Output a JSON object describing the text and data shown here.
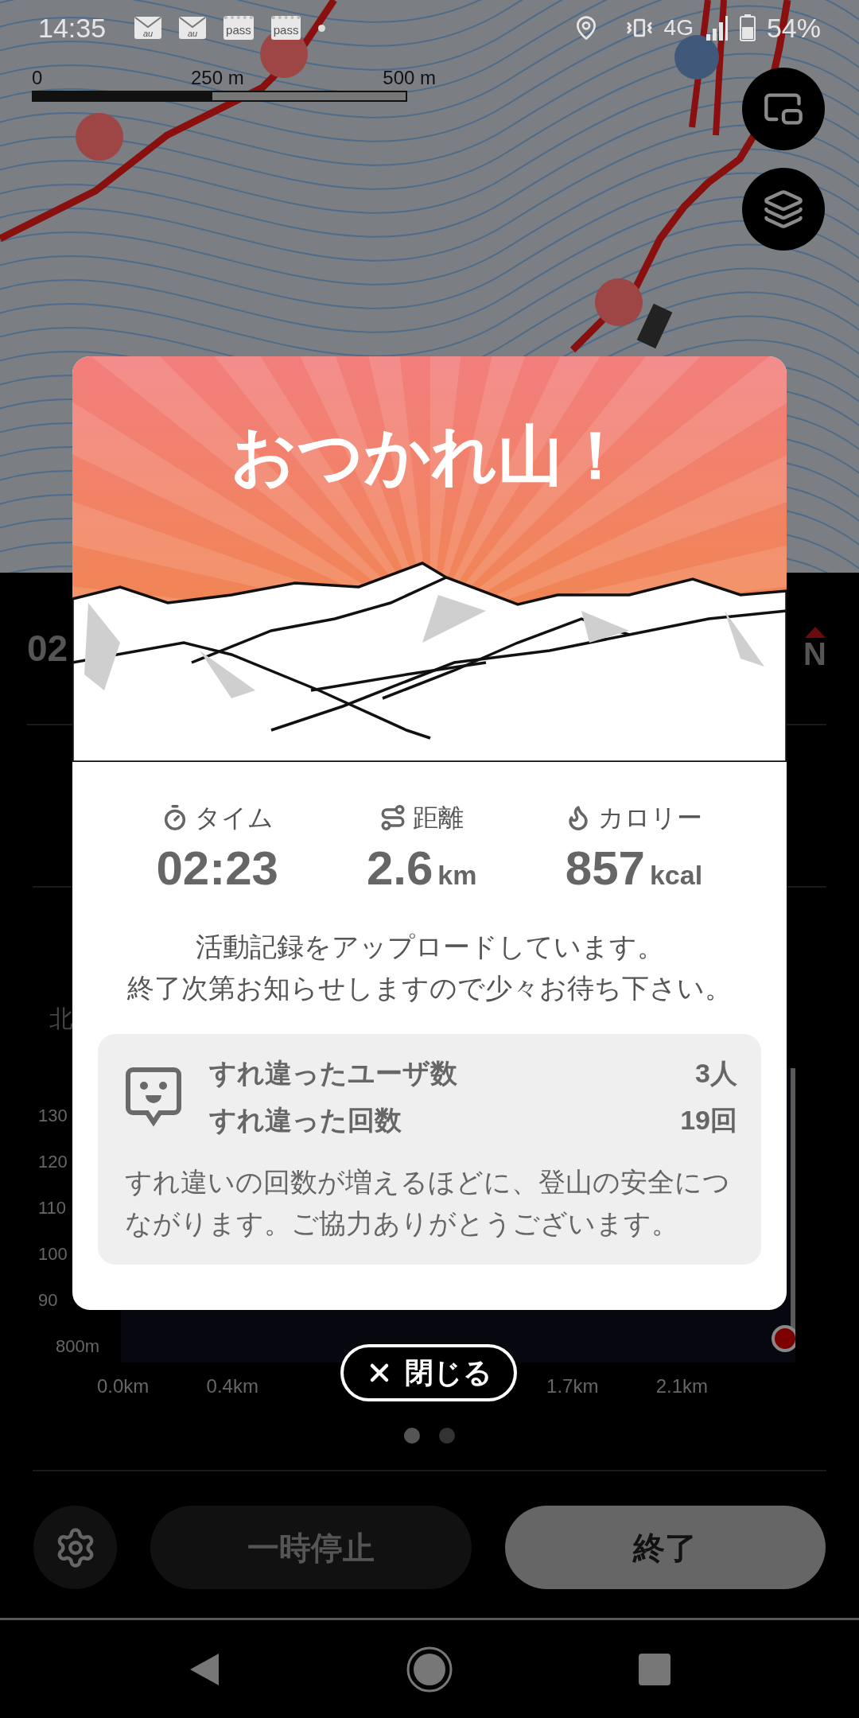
{
  "status_bar": {
    "time": "14:35",
    "notifications": [
      {
        "kind": "mail",
        "label": "au"
      },
      {
        "kind": "mail",
        "label": "au"
      },
      {
        "kind": "pass",
        "label": "pass"
      },
      {
        "kind": "pass",
        "label": "pass"
      },
      {
        "kind": "dot"
      }
    ],
    "network": "4G",
    "battery": "54%"
  },
  "map": {
    "scale_labels": [
      "0",
      "250 m",
      "500 m"
    ]
  },
  "sheet": {
    "stat_value": "02",
    "compass": "N",
    "direction_label": "北",
    "elevation_y_labels": [
      "130",
      "120",
      "110",
      "100",
      "90",
      "800m"
    ],
    "elevation_x_labels": [
      "0.0km",
      "0.4km",
      "1.7km",
      "2.1km"
    ]
  },
  "modal": {
    "title": "おつかれ山！",
    "stats": [
      {
        "kind": "time",
        "label": "タイム",
        "value": "02:23"
      },
      {
        "kind": "distance",
        "label": "距離",
        "value": "2.6",
        "unit": "km"
      },
      {
        "kind": "calories",
        "label": "カロリー",
        "value": "857",
        "unit": "kcal"
      }
    ],
    "message_lines": [
      "活動記録をアップロードしています。",
      "終了次第お知らせしますので少々お待ち下さい。"
    ],
    "encounters": {
      "rows": [
        {
          "label": "すれ違ったユーザ数",
          "value": "3人"
        },
        {
          "label": "すれ違った回数",
          "value": "19回"
        }
      ],
      "note": "すれ違いの回数が増えるほどに、登山の安全につながります。ご協力ありがとうございます。"
    }
  },
  "close_button": {
    "label": "閉じる"
  },
  "pager": [
    {
      "selected": true
    },
    {
      "selected": false
    }
  ],
  "controls": {
    "pause": "一時停止",
    "finish": "終了"
  }
}
